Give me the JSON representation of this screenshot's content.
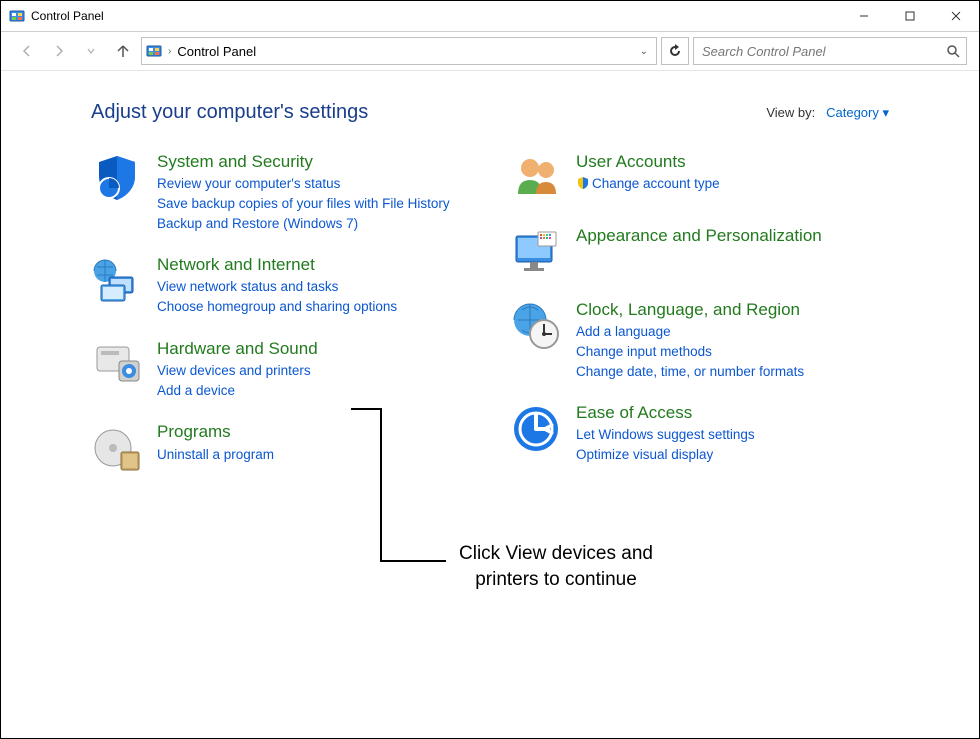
{
  "window": {
    "title": "Control Panel"
  },
  "breadcrumb": {
    "label": "Control Panel"
  },
  "search": {
    "placeholder": "Search Control Panel"
  },
  "heading": "Adjust your computer's settings",
  "viewby": {
    "label": "View by:",
    "mode": "Category ▾"
  },
  "left": [
    {
      "icon": "shield",
      "title": "System and Security",
      "links": [
        "Review your computer's status",
        "Save backup copies of your files with File History",
        "Backup and Restore (Windows 7)"
      ]
    },
    {
      "icon": "network",
      "title": "Network and Internet",
      "links": [
        "View network status and tasks",
        "Choose homegroup and sharing options"
      ]
    },
    {
      "icon": "hardware",
      "title": "Hardware and Sound",
      "links": [
        "View devices and printers",
        "Add a device"
      ]
    },
    {
      "icon": "programs",
      "title": "Programs",
      "links": [
        "Uninstall a program"
      ]
    }
  ],
  "right": [
    {
      "icon": "users",
      "title": "User Accounts",
      "links": [
        {
          "text": "Change account type",
          "shield": true
        }
      ]
    },
    {
      "icon": "appearance",
      "title": "Appearance and Personalization",
      "links": []
    },
    {
      "icon": "clock",
      "title": "Clock, Language, and Region",
      "links": [
        "Add a language",
        "Change input methods",
        "Change date, time, or number formats"
      ]
    },
    {
      "icon": "ease",
      "title": "Ease of Access",
      "links": [
        "Let Windows suggest settings",
        "Optimize visual display"
      ]
    }
  ],
  "callout": "Click View devices and printers to continue"
}
